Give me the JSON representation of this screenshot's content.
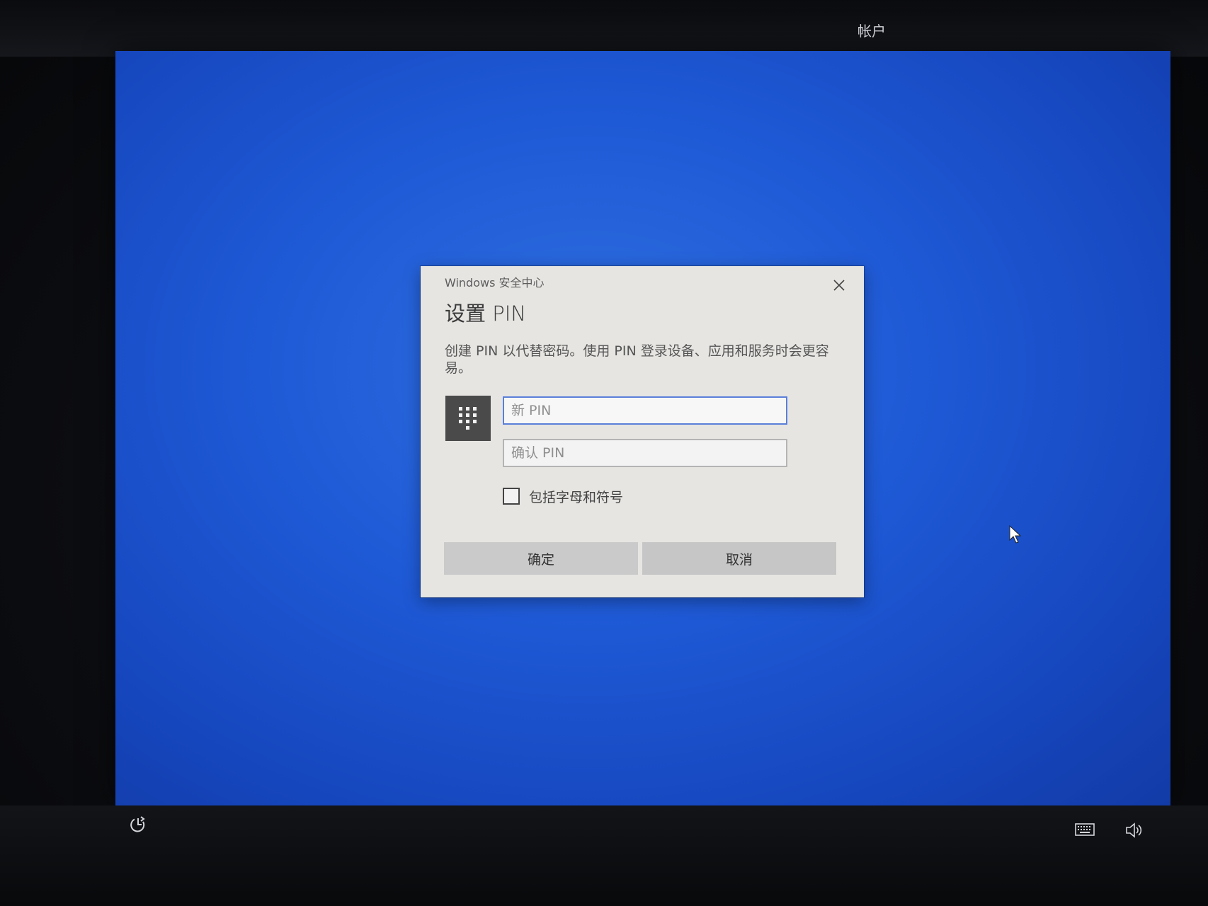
{
  "header": {
    "active_tab": "帐户"
  },
  "dialog": {
    "app_title": "Windows 安全中心",
    "title": "设置 PIN",
    "description": "创建 PIN 以代替密码。使用 PIN 登录设备、应用和服务时会更容易。",
    "new_pin_placeholder": "新 PIN",
    "confirm_pin_placeholder": "确认 PIN",
    "include_letters_symbols_label": "包括字母和符号",
    "include_letters_symbols_checked": false,
    "ok_label": "确定",
    "cancel_label": "取消"
  },
  "icons": {
    "close": "close-icon",
    "keypad": "keypad-icon",
    "ease_of_access": "ease-of-access-icon",
    "keyboard": "keyboard-icon",
    "volume": "volume-icon",
    "cursor": "mouse-cursor-icon"
  },
  "colors": {
    "screen_blue": "#1f5ad6",
    "dialog_bg": "#e6e5e2",
    "button_bg": "#cacaca",
    "active_input_border": "#5a7fd9"
  }
}
